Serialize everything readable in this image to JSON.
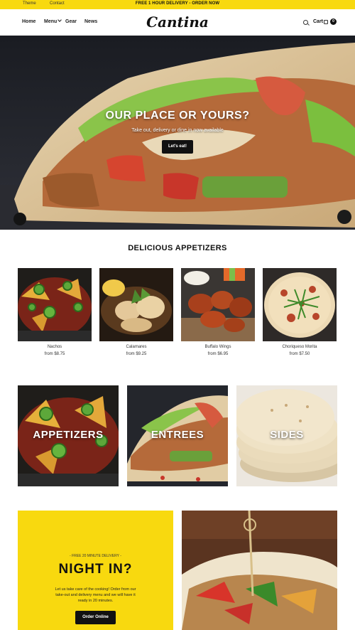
{
  "announcement": {
    "theme_link": "Theme",
    "contact_link": "Contact",
    "promo": "FREE 1 HOUR DELIVERY - ORDER NOW"
  },
  "header": {
    "nav": [
      "Home",
      "Menu",
      "Gear",
      "News"
    ],
    "logo": "Cantina",
    "cart_label": "Cart",
    "cart_count": "0"
  },
  "hero": {
    "title": "OUR PLACE OR YOURS?",
    "subtitle": "Take out, delivery or dine in now available",
    "button": "Let's eat!"
  },
  "appetizers": {
    "title": "DELICIOUS APPETIZERS",
    "items": [
      {
        "name": "Nachos",
        "price": "from $8.75"
      },
      {
        "name": "Calamares",
        "price": "from $9.25"
      },
      {
        "name": "Buffalo Wings",
        "price": "from $6.95"
      },
      {
        "name": "Choriqueso Morita",
        "price": "from $7.50"
      }
    ]
  },
  "collections": [
    {
      "label": "APPETIZERS"
    },
    {
      "label": "ENTREES"
    },
    {
      "label": "SIDES"
    }
  ],
  "night_in": {
    "kicker": "- FREE 20 MINUTE DELIVERY -",
    "title": "NIGHT IN?",
    "text": "Let us take care of the cooking! Order from our take-out and delivery menu and we will have it ready in 20 minutes.",
    "button": "Order Online"
  },
  "colors": {
    "brand_yellow": "#f8d90f",
    "button_black": "#111111"
  }
}
